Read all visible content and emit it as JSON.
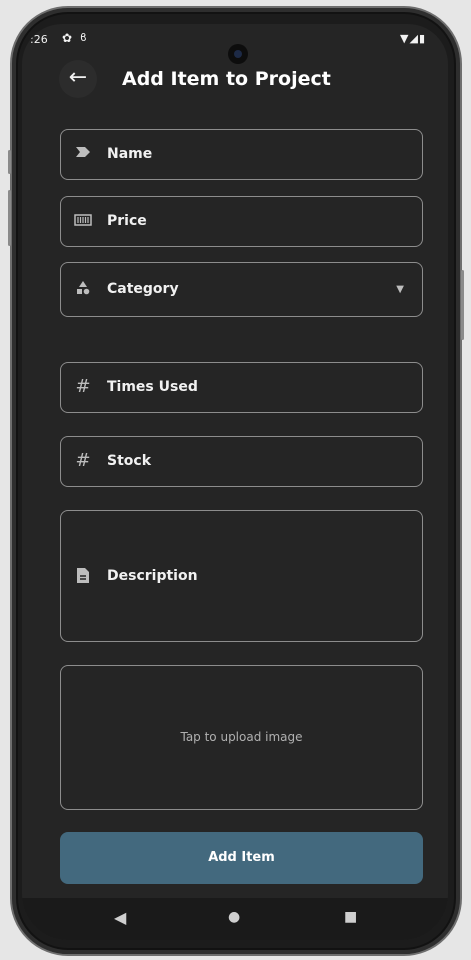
{
  "status_bar": {
    "time": ":26",
    "icons": [
      "settings-icon",
      "notification-icon",
      "wifi-icon",
      "signal-icon",
      "battery-icon"
    ]
  },
  "app_bar": {
    "title": "Add Item to Project"
  },
  "form": {
    "fields": [
      {
        "label": "Name",
        "icon": "label-arrow-icon"
      },
      {
        "label": "Price",
        "icon": "barcode-icon"
      },
      {
        "label": "Category",
        "icon": "category-shapes-icon",
        "type": "dropdown"
      },
      {
        "label": "Times Used",
        "icon": "hash-icon"
      },
      {
        "label": "Stock",
        "icon": "hash-icon"
      },
      {
        "label": "Description",
        "icon": "document-icon",
        "type": "multiline"
      }
    ],
    "upload_prompt": "Tap to upload image",
    "submit_label": "Add Item"
  },
  "nav": {
    "buttons": [
      "back-triangle-icon",
      "home-circle-icon",
      "recents-square-icon"
    ]
  },
  "colors": {
    "background": "#252525",
    "border": "#8d8d8d",
    "accent": "#43697e"
  }
}
